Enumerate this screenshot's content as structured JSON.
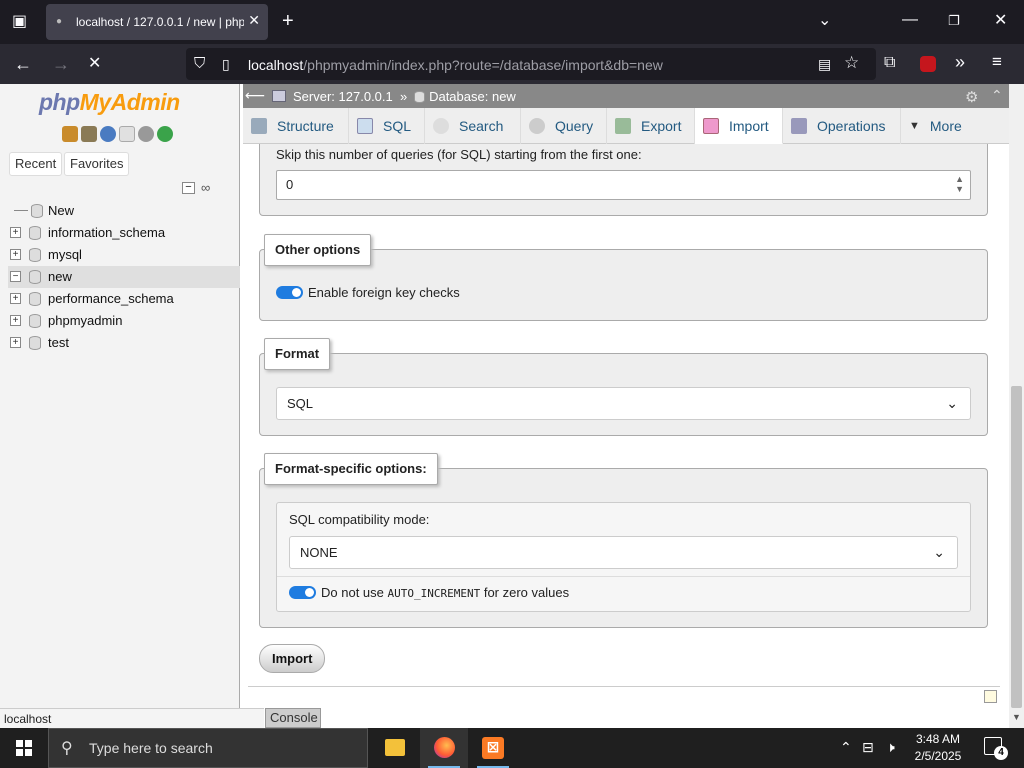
{
  "browser": {
    "tab_title": "localhost / 127.0.0.1 / new | php",
    "url_host": "localhost",
    "url_path": "/phpmyadmin/index.php?route=/database/import&db=new"
  },
  "nav": {
    "logo_php": "php",
    "logo_myadmin": "MyAdmin",
    "recent_label": "Recent",
    "favorites_label": "Favorites",
    "tree": [
      {
        "label": "New",
        "expander": ""
      },
      {
        "label": "information_schema",
        "expander": "+"
      },
      {
        "label": "mysql",
        "expander": "+"
      },
      {
        "label": "new",
        "expander": "−"
      },
      {
        "label": "performance_schema",
        "expander": "+"
      },
      {
        "label": "phpmyadmin",
        "expander": "+"
      },
      {
        "label": "test",
        "expander": "+"
      }
    ]
  },
  "breadcrumb": {
    "server_label": "Server:",
    "server_value": "127.0.0.1",
    "separator": "»",
    "database_label": "Database:",
    "database_value": "new"
  },
  "tabs": {
    "structure": "Structure",
    "sql": "SQL",
    "search": "Search",
    "query": "Query",
    "export": "Export",
    "import": "Import",
    "operations": "Operations",
    "more": "More"
  },
  "form": {
    "skip_label": "Skip this number of queries (for SQL) starting from the first one:",
    "skip_value": "0",
    "other_options_legend": "Other options",
    "foreign_key_label": "Enable foreign key checks",
    "format_legend": "Format",
    "format_value": "SQL",
    "format_specific_legend": "Format-specific options:",
    "sql_compat_label": "SQL compatibility mode:",
    "sql_compat_value": "NONE",
    "auto_inc_prefix": "Do not use",
    "auto_inc_code": "AUTO_INCREMENT",
    "auto_inc_suffix": "for zero values",
    "import_button": "Import"
  },
  "status_bar": {
    "host": "localhost",
    "console": "Console"
  },
  "taskbar": {
    "search_placeholder": "Type here to search",
    "time": "3:48 AM",
    "date": "2/5/2025",
    "notification_count": "4"
  }
}
